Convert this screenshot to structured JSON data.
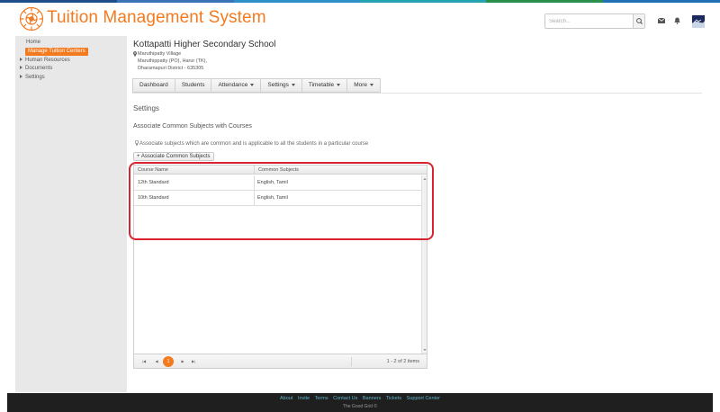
{
  "app": {
    "title": "Tuition Management System",
    "logo_icon": "sunburst-logo-icon"
  },
  "header": {
    "search_placeholder": "Search...",
    "search_icon": "search-icon",
    "mail_icon": "envelope-icon",
    "notification_icon": "bell-icon",
    "stripe_colors": [
      "#1d4e89",
      "#3b73b9",
      "#2c8fc9",
      "#26a3b0",
      "#2a8f4c",
      "#1f6fb5"
    ]
  },
  "sidebar": {
    "home": "Home",
    "active_item": "Manage Tuition Centers",
    "items": [
      {
        "label": "Human Resources"
      },
      {
        "label": "Documents"
      },
      {
        "label": "Settings"
      }
    ]
  },
  "school": {
    "name": "Kottapatti Higher Secondary School",
    "address": [
      "Maruthipatty Village",
      "Maruthippatty (PO), Harur (TK),",
      "Dharamapuri District - 635305"
    ]
  },
  "tabs": [
    {
      "label": "Dashboard",
      "dropdown": false
    },
    {
      "label": "Students",
      "dropdown": false
    },
    {
      "label": "Attendance",
      "dropdown": true
    },
    {
      "label": "Settings",
      "dropdown": true
    },
    {
      "label": "Timetable",
      "dropdown": true
    },
    {
      "label": "More",
      "dropdown": true
    }
  ],
  "page": {
    "section_title": "Settings",
    "sub_title": "Associate Common Subjects with Courses",
    "hint": "Associate subjects which are common and is applicable to all the students in a particular course",
    "associate_button": "+ Associate Common Subjects"
  },
  "grid": {
    "columns": [
      "Course Name",
      "Common Subjects"
    ],
    "rows": [
      {
        "course": "12th Standard",
        "subjects": "English, Tamil"
      },
      {
        "course": "10th Standard",
        "subjects": "English, Tamil"
      }
    ],
    "pager": {
      "current_page": "1",
      "info": "1 - 2 of 2 items"
    }
  },
  "footer": {
    "links": [
      "About",
      "Invite",
      "Terms",
      "Contact Us",
      "Banners",
      "Tickets",
      "Support Center"
    ],
    "copyright": "The Good Grid ©"
  },
  "colors": {
    "accent": "#f47a20",
    "highlight": "#d9232f",
    "footer_bg": "#1f1f1f",
    "footer_link": "#5fb4c9"
  }
}
